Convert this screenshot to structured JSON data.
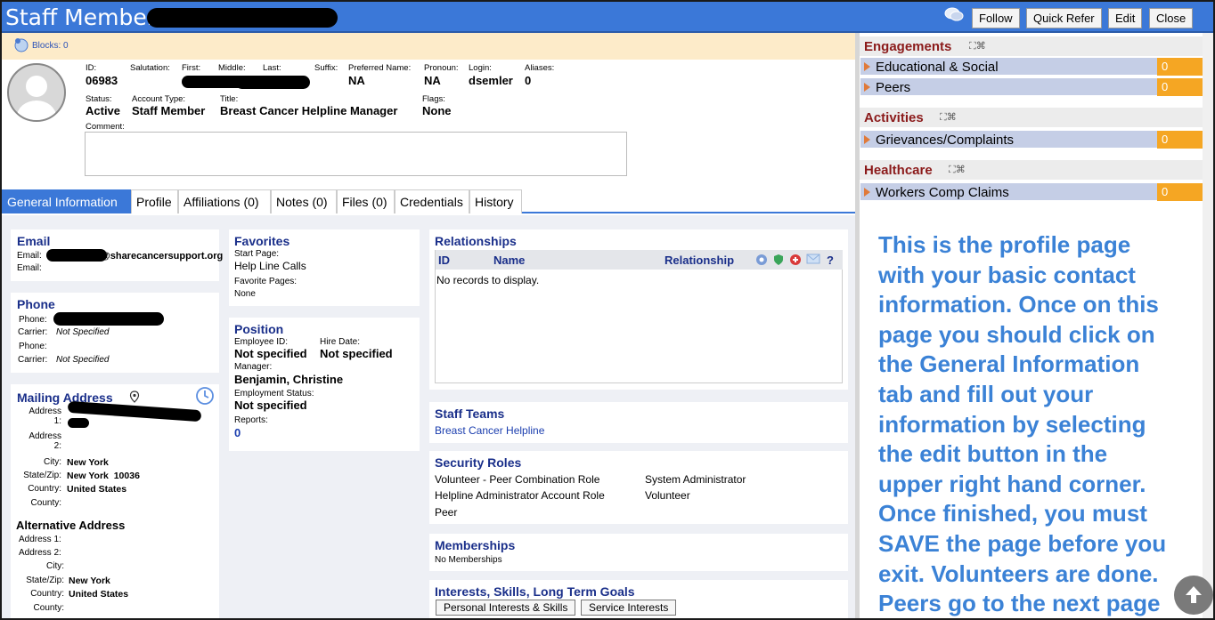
{
  "titlebar": {
    "title": "Staff Member:",
    "follow": "Follow",
    "quick_refer": "Quick Refer",
    "edit": "Edit",
    "close": "Close"
  },
  "blocks": {
    "label": "Blocks: 0"
  },
  "profile": {
    "id_label": "ID:",
    "id": "06983",
    "salutation_label": "Salutation:",
    "first_label": "First:",
    "middle_label": "Middle:",
    "last_label": "Last:",
    "suffix_label": "Suffix:",
    "preferred_label": "Preferred Name:",
    "preferred": "NA",
    "pronoun_label": "Pronoun:",
    "pronoun": "NA",
    "login_label": "Login:",
    "login": "dsemler",
    "aliases_label": "Aliases:",
    "aliases": "0",
    "status_label": "Status:",
    "status": "Active",
    "account_label": "Account Type:",
    "account": "Staff Member",
    "title_label": "Title:",
    "title": "Breast Cancer Helpline Manager",
    "flags_label": "Flags:",
    "flags": "None",
    "comment_label": "Comment:"
  },
  "tabs": [
    "General Information",
    "Profile",
    "Affiliations (0)",
    "Notes (0)",
    "Files (0)",
    "Credentials",
    "History"
  ],
  "email": {
    "heading": "Email",
    "label1": "Email:",
    "value1": "@sharecancersupport.org",
    "label2": "Email:"
  },
  "phone": {
    "heading": "Phone",
    "phone_label": "Phone:",
    "carrier_label": "Carrier:",
    "carrier1": "Not Specified",
    "phone2_label": "Phone:",
    "carrier2_label": "Carrier:",
    "carrier2": "Not Specified"
  },
  "mailing": {
    "heading": "Mailing Address",
    "addr1": "Address 1:",
    "addr2": "Address 2:",
    "city_label": "City:",
    "city": "New York",
    "statezip_label": "State/Zip:",
    "statezip": "New York  10036",
    "country_label": "Country:",
    "country": "United States",
    "county_label": "County:"
  },
  "alt": {
    "heading": "Alternative Address",
    "addr1": "Address 1:",
    "addr2": "Address 2:",
    "city_label": "City:",
    "statezip_label": "State/Zip:",
    "statezip": "New York",
    "country_label": "Country:",
    "country": "United States",
    "county_label": "County:"
  },
  "favorites": {
    "heading": "Favorites",
    "start_label": "Start Page:",
    "start": "Help Line Calls",
    "fav_label": "Favorite Pages:",
    "fav": "None"
  },
  "position": {
    "heading": "Position",
    "empid_label": "Employee ID:",
    "empid": "Not specified",
    "hire_label": "Hire Date:",
    "hire": "Not specified",
    "manager_label": "Manager:",
    "manager": "Benjamin, Christine",
    "empstatus_label": "Employment Status:",
    "empstatus": "Not specified",
    "reports_label": "Reports:",
    "reports": "0"
  },
  "relationships": {
    "heading": "Relationships",
    "col_id": "ID",
    "col_name": "Name",
    "col_rel": "Relationship",
    "help": "?",
    "empty": "No records to display."
  },
  "staff_teams": {
    "heading": "Staff Teams",
    "team": "Breast Cancer Helpline"
  },
  "security": {
    "heading": "Security Roles",
    "roles": [
      "Volunteer - Peer Combination Role",
      "System Administrator",
      "Helpline Administrator Account Role",
      "Volunteer",
      "Peer"
    ]
  },
  "memberships": {
    "heading": "Memberships",
    "text": "No Memberships"
  },
  "interests": {
    "heading": "Interests, Skills, Long Term Goals",
    "btn1": "Personal Interests & Skills",
    "btn2": "Service Interests"
  },
  "right": {
    "engagements": "Engagements",
    "eng_items": [
      {
        "name": "Educational & Social",
        "count": "0"
      },
      {
        "name": "Peers",
        "count": "0"
      }
    ],
    "activities": "Activities",
    "act_items": [
      {
        "name": "Grievances/Complaints",
        "count": "0"
      }
    ],
    "healthcare": "Healthcare",
    "hc_items": [
      {
        "name": "Workers Comp Claims",
        "count": "0"
      }
    ]
  },
  "note": "This is the profile page\nwith your basic contact\ninformation. Once on this\npage you should click on\nthe General Information\ntab and fill out your\ninformation by selecting\nthe edit button in the\nupper right hand corner.\nOnce finished, you must\nSAVE the page before you\nexit. Volunteers are done.\nPeers go to the next page",
  "colors": {
    "titlebar": "#3b78d8",
    "heading": "#1a2f8a",
    "engagement_heading": "#8b1a1a",
    "count_badge": "#f5a623",
    "note": "#3b82d6"
  }
}
